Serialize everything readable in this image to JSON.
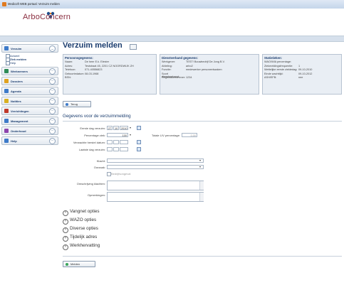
{
  "window": {
    "title": "Medicoft WEB portaal: Verzuim melden"
  },
  "brand": {
    "logo_text": "ArboConcern"
  },
  "sidebar": {
    "items": [
      {
        "label": "Verzuim",
        "icon": "doctor-icon",
        "color": "#3d7ac9",
        "subs": [
          "Actueel",
          "Ziek melden",
          "Help"
        ]
      },
      {
        "label": "Werknemers",
        "icon": "person-icon",
        "color": "#2e8b57"
      },
      {
        "label": "Dossiers",
        "icon": "folder-icon",
        "color": "#e0a21f"
      },
      {
        "label": "Agenda",
        "icon": "calendar-icon",
        "color": "#3d7ac9"
      },
      {
        "label": "Notities",
        "icon": "note-icon",
        "color": "#d9b020"
      },
      {
        "label": "Verrichtingen",
        "icon": "pencil-icon",
        "color": "#c0392b"
      },
      {
        "label": "Management",
        "icon": "chart-icon",
        "color": "#3d7ac9"
      },
      {
        "label": "Onderhoud",
        "icon": "wrench-icon",
        "color": "#8e44ad"
      },
      {
        "label": "Help",
        "icon": "help-icon",
        "color": "#3d7ac9"
      }
    ]
  },
  "page": {
    "title": "Verzuim melden"
  },
  "persoon": {
    "header": "Persoonsgegevens:",
    "rows": [
      {
        "k": "Naam:",
        "v": "De heer E.k. Elester"
      },
      {
        "k": "Adres:",
        "v": "Teststraat 45, 2201 CZ  NOORDWIJK ZH"
      },
      {
        "k": "Telefoon:",
        "v": "071-40556823"
      },
      {
        "k": "Geboortedatum:",
        "v": "08-03-1968"
      },
      {
        "k": "BSN:",
        "v": ""
      }
    ]
  },
  "dienstverband": {
    "header": "Dienstverband gegevens:",
    "rows": [
      {
        "k": "Werkgever:",
        "v": "TEST! Bouwbedrijf De Jong B.V."
      },
      {
        "k": "Afdeling:",
        "v": "arbo2"
      },
      {
        "k": "Functie:",
        "v": "medewerker personeelszaken"
      },
      {
        "k": "Soort dienstverband:",
        "v": ""
      },
      {
        "k": "Registratienummer:",
        "v": "1234"
      }
    ]
  },
  "statistieken": {
    "header": "Statistieken:",
    "rows": [
      {
        "k": "WAO/WIA percentage:",
        "v": ""
      },
      {
        "k": "Ziekmeldingsfrequentie:",
        "v": "1"
      },
      {
        "k": "Wettelijke eerste ziektedag:",
        "v": "09-10-2010"
      },
      {
        "k": "Einde wachttijd:",
        "v": "09-10-2012"
      },
      {
        "k": "ASH/EFB:",
        "v": "nee"
      }
    ]
  },
  "buttons": {
    "terug": "Terug",
    "melden": "Melden"
  },
  "form": {
    "section_title": "Gegevens voor de verzuimmelding",
    "eerste_dag_label": "Eerste dag verzuim:",
    "eerste_dag": {
      "d": "27",
      "m": "10",
      "y": "2010"
    },
    "percentage_label": "Percentage ziek:",
    "percentage": "100",
    "totale_lw_label": "Totale LIV percentage:",
    "totale_lw": "0.00",
    "verwachte_label": "Verwachte herstel datum:",
    "laatste_label": "Laatste dag verzuim:",
    "klacht_label": "Klacht:",
    "oorzaak_label": "Oorzaak:",
    "bedrijfsongeval_label": "Bedrijfsongeval",
    "omschrijving_label": "Omschrijving klachten:",
    "opmerkingen_label": "Opmerkingen:"
  },
  "collapsibles": [
    "Vangnet opties",
    "WAZO opties",
    "Diverse opties",
    "Tijdelijk adres",
    "Werkhervatting"
  ]
}
